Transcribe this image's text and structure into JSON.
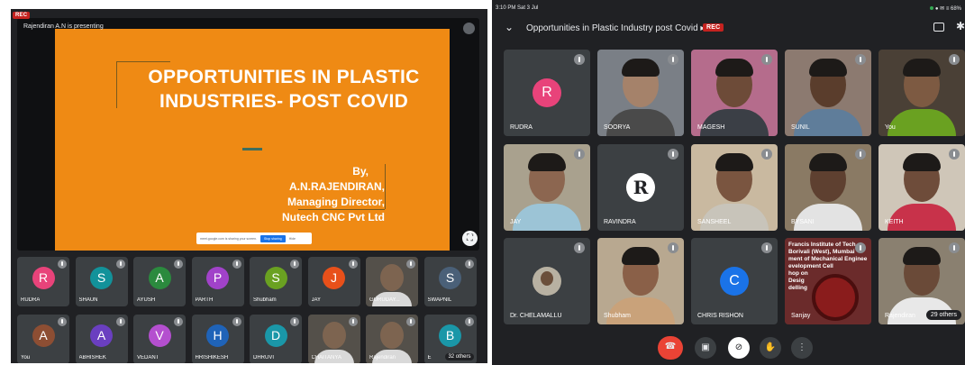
{
  "left": {
    "rec": "REC",
    "presenting": "Rajendiran A.N is presenting",
    "slide": {
      "title_line1": "OPPORTUNITIES IN PLASTIC",
      "title_line2": "INDUSTRIES- POST COVID",
      "by": "By,",
      "author": "A.N.RAJENDIRAN,",
      "role": "Managing Director,",
      "company": "Nutech CNC Pvt Ltd"
    },
    "share_bar": {
      "text": "meet.google.com is sharing your screen.",
      "stop": "Stop sharing",
      "hide": "Hide"
    },
    "participants": [
      {
        "name": "RUDRA",
        "initial": "R",
        "color": "#e8437a"
      },
      {
        "name": "SHAUN",
        "initial": "S",
        "color": "#12929a"
      },
      {
        "name": "AYUSH",
        "initial": "A",
        "color": "#2b8a3e"
      },
      {
        "name": "PARTH",
        "initial": "P",
        "color": "#a142c9"
      },
      {
        "name": "Shubham",
        "initial": "S",
        "color": "#6aa121"
      },
      {
        "name": "JAY",
        "initial": "J",
        "color": "#e8501a"
      },
      {
        "name": "GURUDAY...",
        "initial": "",
        "color": ""
      },
      {
        "name": "SWAPNIL",
        "initial": "S",
        "color": "#4a6078"
      },
      {
        "name": "You",
        "initial": "A",
        "color": "#8d4e33"
      },
      {
        "name": "ABHISHEK",
        "initial": "A",
        "color": "#6a3fc0"
      },
      {
        "name": "VEDANT",
        "initial": "V",
        "color": "#b44fcf"
      },
      {
        "name": "HRISHIKESH",
        "initial": "H",
        "color": "#1f63b8"
      },
      {
        "name": "DHRUVI",
        "initial": "D",
        "color": "#1a97a8"
      },
      {
        "name": "CHAITANYA",
        "initial": "",
        "color": ""
      },
      {
        "name": "Rajendiran",
        "initial": "",
        "color": ""
      },
      {
        "name": "E",
        "initial": "B",
        "color": "#1a97a8",
        "others": "32 others"
      }
    ]
  },
  "right": {
    "status_time": "3:10 PM  Sat 3 Jul",
    "status_icons": "● ✉ ≡ 68%",
    "back_icon": "⌄",
    "meeting_title": "Opportunities in Plastic Industry post Covid ▸",
    "rec": "REC",
    "tiles": [
      {
        "name": "RUDRA",
        "kind": "avatar",
        "initial": "R",
        "color": "#e8437a"
      },
      {
        "name": "SOORYA",
        "kind": "video",
        "skin": "#a5826a",
        "shirt": "#4a4a4a",
        "bg": "#7a7f86"
      },
      {
        "name": "MAGESH",
        "kind": "video",
        "skin": "#6d4b38",
        "shirt": "#3b3f46",
        "bg": "#b56c8c"
      },
      {
        "name": "SUNIL",
        "kind": "video",
        "skin": "#5a3d2c",
        "shirt": "#5f7d9a",
        "bg": "#8c7a70"
      },
      {
        "name": "You",
        "kind": "video",
        "skin": "#7d5a42",
        "shirt": "#6aa121",
        "bg": "#4a4036"
      },
      {
        "name": "JAY",
        "kind": "video",
        "skin": "#8c6650",
        "shirt": "#9cc4d6",
        "bg": "#a9a18e"
      },
      {
        "name": "RAVINDRA",
        "kind": "logo",
        "initial": "R"
      },
      {
        "name": "SANSHEEL",
        "kind": "video",
        "skin": "#7a5540",
        "shirt": "#c8c4ba",
        "bg": "#c9b9a0"
      },
      {
        "name": "BYSANI",
        "kind": "video",
        "skin": "#5e4030",
        "shirt": "#e3e3e3",
        "bg": "#8a7a64"
      },
      {
        "name": "KEITH",
        "kind": "video",
        "skin": "#6e4c3a",
        "shirt": "#c8324a",
        "bg": "#cfc6b8"
      },
      {
        "name": "Dr. CHELAMALLU",
        "kind": "small-photo"
      },
      {
        "name": "Shubham",
        "kind": "video",
        "skin": "#8a6048",
        "shirt": "#c9a27a",
        "bg": "#b8a890"
      },
      {
        "name": "CHRIS RISHON",
        "kind": "avatar",
        "initial": "C",
        "color": "#1a73e8"
      },
      {
        "name": "Sanjay",
        "kind": "slide",
        "text": "Francis Institute of Tech\nBorivali (West), Mumbai\nment of Mechanical Enginee\nevelopment Cell\nhop on\nDesig\ndelling"
      },
      {
        "name": "Rajendiran",
        "kind": "video",
        "skin": "#6a4a38",
        "shirt": "#e8e8e8",
        "bg": "#8a8070",
        "others": "29 others"
      }
    ],
    "controls": {
      "end_icon": "☎",
      "camera_icon": "▣",
      "mic_icon": "⊘",
      "hand_icon": "✋",
      "more_icon": "⋮"
    }
  }
}
